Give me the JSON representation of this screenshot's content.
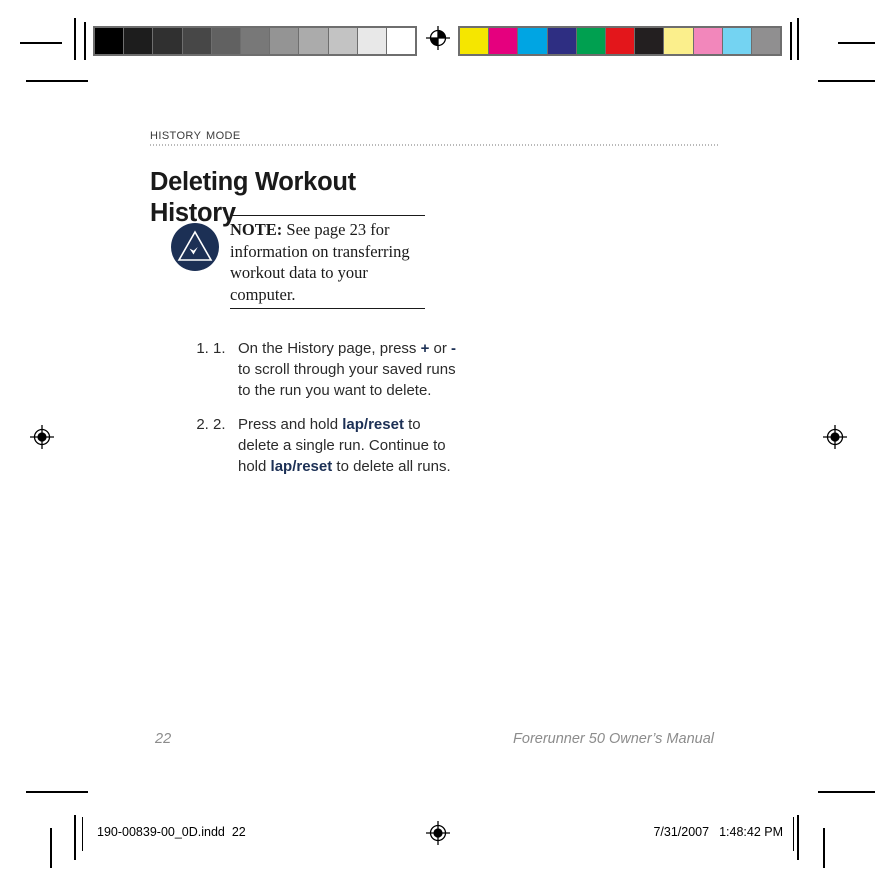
{
  "document": {
    "section_label": "History Mode",
    "title": "Deleting Workout History",
    "title_line1": "Deleting Workout",
    "title_line2": "History"
  },
  "note": {
    "icon": "note-triangle-check-icon",
    "label": "NOTE:",
    "text": " See page 23 for information on transferring workout data to your computer."
  },
  "steps": [
    {
      "number": "1.",
      "text_parts": [
        {
          "type": "plain",
          "text": "On the History page, press "
        },
        {
          "type": "key",
          "text": "+"
        },
        {
          "type": "plain",
          "text": " or "
        },
        {
          "type": "key",
          "text": "-"
        },
        {
          "type": "plain",
          "text": " to scroll through your saved runs to the run you want to delete."
        }
      ],
      "part_1": "On the History page, press ",
      "part_2": "+",
      "part_3": " or ",
      "part_4": "-",
      "part_5": " to scroll through your saved runs to the run you want to delete."
    },
    {
      "number": "2.",
      "text_parts": [
        {
          "type": "plain",
          "text": "Press and hold "
        },
        {
          "type": "key",
          "text": "lap/reset"
        },
        {
          "type": "plain",
          "text": " to delete a single run. Continue to hold "
        },
        {
          "type": "key",
          "text": "lap/reset"
        },
        {
          "type": "plain",
          "text": " to delete all runs."
        }
      ],
      "part_1": "Press and hold ",
      "part_2": "lap/reset",
      "part_3": " to delete a single run. Continue to hold ",
      "part_4": "lap/reset",
      "part_5": " to delete all runs."
    }
  ],
  "footer": {
    "page_number": "22",
    "manual_title": "Forerunner 50 Owner’s Manual"
  },
  "slug": {
    "filename": "190-00839-00_0D.indd",
    "page": "22",
    "date": "7/31/2007",
    "time": "1:48:42 PM"
  },
  "prepress": {
    "gray_bar": {
      "name": "grayscale-step-wedge",
      "patches": [
        "#000000",
        "#1d1d1d",
        "#303030",
        "#474747",
        "#616161",
        "#787878",
        "#949494",
        "#ababab",
        "#c3c3c3",
        "#e8e8e8",
        "#ffffff"
      ]
    },
    "color_bar": {
      "name": "process-color-control-bar",
      "patches": [
        "#f5e600",
        "#e5007e",
        "#00a5e3",
        "#2e2e82",
        "#00a050",
        "#e3161b",
        "#231f20",
        "#fbef8c",
        "#f287bb",
        "#74d3f2",
        "#908f90"
      ]
    },
    "registration_marks": 4,
    "colors": {
      "note_navy": "#1c3055",
      "footer_gray": "#8c8c8c",
      "rule_gray": "#b9b9b9"
    }
  }
}
